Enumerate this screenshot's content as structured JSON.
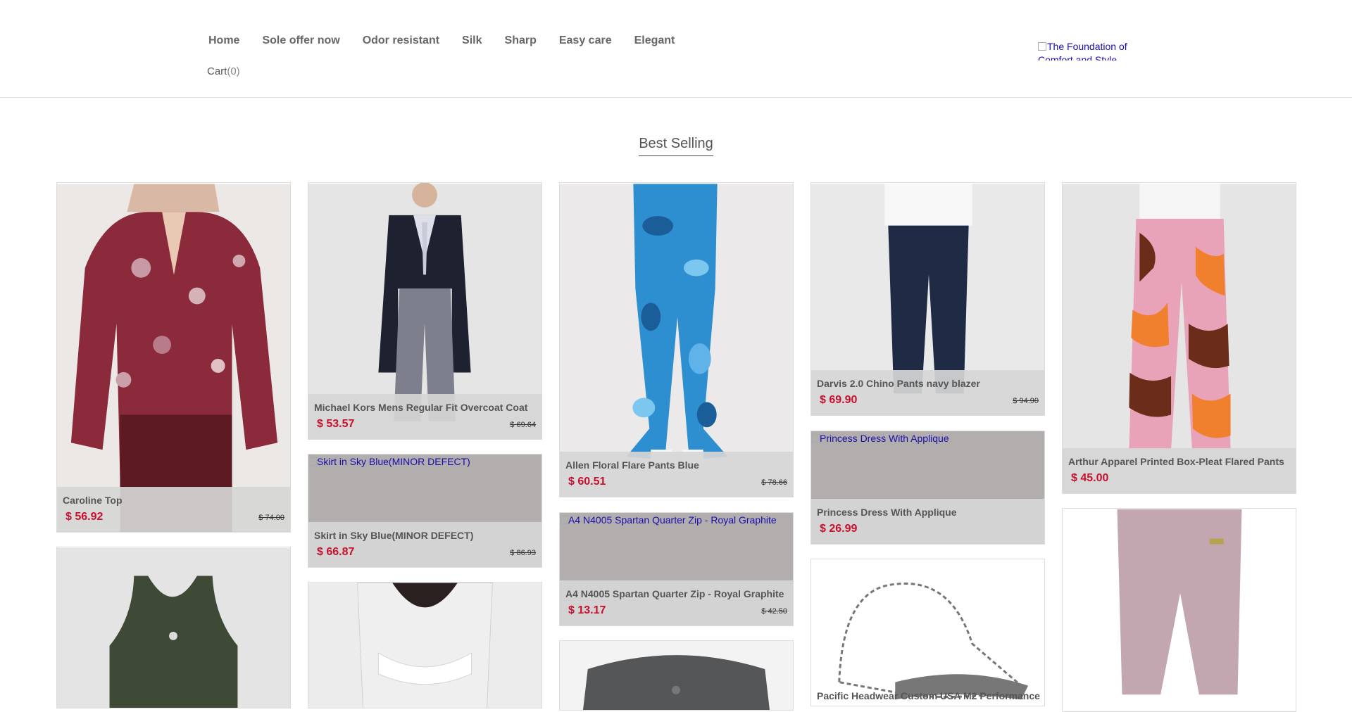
{
  "nav": [
    "Home",
    "Sole offer now",
    "Odor resistant",
    "Silk",
    "Sharp",
    "Easy care",
    "Elegant"
  ],
  "cart": {
    "label": "Cart",
    "count": "(0)"
  },
  "logo_alt": "The Foundation of Comfort and Style",
  "section_title": "Best Selling",
  "products": [
    {
      "title": "Caroline Top",
      "price": "$ 56.92",
      "old_price": "$ 74.00"
    },
    {
      "title": "Michael Kors Mens Regular Fit Overcoat Coat",
      "price": "$ 53.57",
      "old_price": "$ 69.64"
    },
    {
      "title": "Skirt in Sky Blue(MINOR DEFECT)",
      "price": "$ 66.87",
      "old_price": "$ 86.93",
      "image_alt": "Skirt in Sky Blue(MINOR DEFECT)"
    },
    {
      "title": "Allen Floral Flare Pants Blue",
      "price": "$ 60.51",
      "old_price": "$ 78.66"
    },
    {
      "title": "A4 N4005 Spartan Quarter Zip - Royal Graphite",
      "price": "$ 13.17",
      "old_price": "$ 42.50",
      "image_alt": "A4 N4005 Spartan Quarter Zip - Royal Graphite"
    },
    {
      "title": "Darvis 2.0 Chino Pants navy blazer",
      "price": "$ 69.90",
      "old_price": "$ 94.90"
    },
    {
      "title": "Princess Dress With Applique",
      "price": "$ 26.99",
      "old_price": "",
      "image_alt": "Princess Dress With Applique"
    },
    {
      "title": "Pacific Headwear Custom USA M2 Performance",
      "price": "",
      "old_price": ""
    },
    {
      "title": "Arthur Apparel Printed Box-Pleat Flared Pants",
      "price": "$ 45.00",
      "old_price": ""
    }
  ],
  "colors": {
    "price": "#c8102e",
    "link": "#1a0dab",
    "caption_bg": "#d6d6d6",
    "missing_image": "#b3aeae"
  }
}
